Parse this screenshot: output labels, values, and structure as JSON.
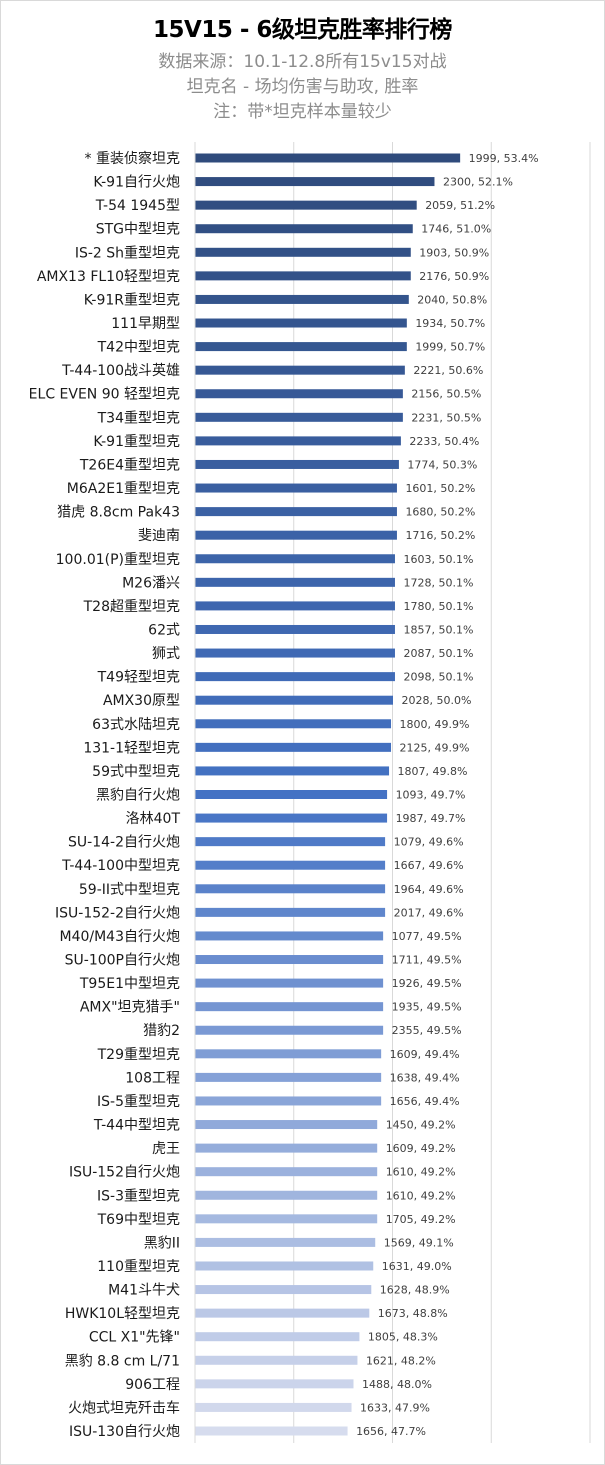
{
  "chart_data": {
    "type": "bar",
    "orientation": "horizontal",
    "title": "15V15 - 6级坦克胜率排行榜",
    "subtitles": [
      "数据来源：10.1-12.8所有15v15对战",
      "坦克名 - 场均伤害与助攻, 胜率",
      "注：带*坦克样本量较少"
    ],
    "xlabel": "",
    "ylabel": "",
    "xlim": [
      40,
      60
    ],
    "x_gridlines": [
      40,
      45,
      50,
      55,
      60
    ],
    "grid": true,
    "show_x_tick_labels": false,
    "value_unit": "%",
    "color_scale": [
      "#2F4B7C",
      "#4472C4",
      "#D6DCEE"
    ],
    "categories": [
      "* 重装侦察坦克",
      "K-91自行火炮",
      "T-54 1945型",
      "STG中型坦克",
      "IS-2 Sh重型坦克",
      "AMX13 FL10轻型坦克",
      "K-91R重型坦克",
      "111早期型",
      "T42中型坦克",
      "T-44-100战斗英雄",
      "ELC EVEN 90 轻型坦克",
      "T34重型坦克",
      "K-91重型坦克",
      "T26E4重型坦克",
      "M6A2E1重型坦克",
      "猎虎 8.8cm Pak43",
      "斐迪南",
      "100.01(P)重型坦克",
      "M26潘兴",
      "T28超重型坦克",
      "62式",
      "狮式",
      "T49轻型坦克",
      "AMX30原型",
      "63式水陆坦克",
      "131-1轻型坦克",
      "59式中型坦克",
      "黑豹自行火炮",
      "洛林40T",
      "SU-14-2自行火炮",
      "T-44-100中型坦克",
      "59-II式中型坦克",
      "ISU-152-2自行火炮",
      "M40/M43自行火炮",
      "SU-100P自行火炮",
      "T95E1中型坦克",
      "AMX\"坦克猎手\"",
      "猎豹2",
      "T29重型坦克",
      "108工程",
      "IS-5重型坦克",
      "T-44中型坦克",
      "虎王",
      "ISU-152自行火炮",
      "IS-3重型坦克",
      "T69中型坦克",
      "黑豹II",
      "110重型坦克",
      "M41斗牛犬",
      "HWK10L轻型坦克",
      "CCL X1\"先锋\"",
      "黑豹 8.8 cm L/71",
      "906工程",
      "火炮式坦克歼击车",
      "ISU-130自行火炮"
    ],
    "win_rate": [
      53.4,
      52.1,
      51.2,
      51.0,
      50.9,
      50.9,
      50.8,
      50.7,
      50.7,
      50.6,
      50.5,
      50.5,
      50.4,
      50.3,
      50.2,
      50.2,
      50.2,
      50.1,
      50.1,
      50.1,
      50.1,
      50.1,
      50.1,
      50.0,
      49.9,
      49.9,
      49.8,
      49.7,
      49.7,
      49.6,
      49.6,
      49.6,
      49.6,
      49.5,
      49.5,
      49.5,
      49.5,
      49.5,
      49.4,
      49.4,
      49.4,
      49.2,
      49.2,
      49.2,
      49.2,
      49.2,
      49.1,
      49.0,
      48.9,
      48.8,
      48.3,
      48.2,
      48.0,
      47.9,
      47.7
    ],
    "avg_damage_assist": [
      1999,
      2300,
      2059,
      1746,
      1903,
      2176,
      2040,
      1934,
      1999,
      2221,
      2156,
      2231,
      2233,
      1774,
      1601,
      1680,
      1716,
      1603,
      1728,
      1780,
      1857,
      2087,
      2098,
      2028,
      1800,
      2125,
      1807,
      1093,
      1987,
      1079,
      1667,
      1964,
      2017,
      1077,
      1711,
      1926,
      1935,
      2355,
      1609,
      1638,
      1656,
      1450,
      1609,
      1610,
      1610,
      1705,
      1569,
      1631,
      1628,
      1673,
      1805,
      1621,
      1488,
      1633,
      1656
    ],
    "data_labels": [
      "1999, 53.4%",
      "2300, 52.1%",
      "2059, 51.2%",
      "1746, 51.0%",
      "1903, 50.9%",
      "2176, 50.9%",
      "2040, 50.8%",
      "1934, 50.7%",
      "1999, 50.7%",
      "2221, 50.6%",
      "2156, 50.5%",
      "2231, 50.5%",
      "2233, 50.4%",
      "1774, 50.3%",
      "1601, 50.2%",
      "1680, 50.2%",
      "1716, 50.2%",
      "1603, 50.1%",
      "1728, 50.1%",
      "1780, 50.1%",
      "1857, 50.1%",
      "2087, 50.1%",
      "2098, 50.1%",
      "2028, 50.0%",
      "1800, 49.9%",
      "2125, 49.9%",
      "1807, 49.8%",
      "1093, 49.7%",
      "1987, 49.7%",
      "1079, 49.6%",
      "1667, 49.6%",
      "1964, 49.6%",
      "2017, 49.6%",
      "1077, 49.5%",
      "1711, 49.5%",
      "1926, 49.5%",
      "1935, 49.5%",
      "2355, 49.5%",
      "1609, 49.4%",
      "1638, 49.4%",
      "1656, 49.4%",
      "1450, 49.2%",
      "1609, 49.2%",
      "1610, 49.2%",
      "1610, 49.2%",
      "1705, 49.2%",
      "1569, 49.1%",
      "1631, 49.0%",
      "1628, 48.9%",
      "1673, 48.8%",
      "1805, 48.3%",
      "1621, 48.2%",
      "1488, 48.0%",
      "1633, 47.9%",
      "1656, 47.7%"
    ]
  }
}
